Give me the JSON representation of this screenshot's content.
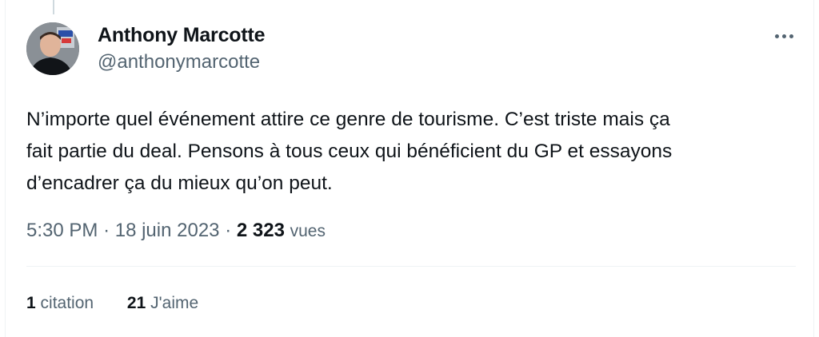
{
  "tweet": {
    "author": {
      "name": "Anthony Marcotte",
      "handle": "@anthonymarcotte",
      "avatar": "avatar-photo"
    },
    "more_icon": "more-horizontal-icon",
    "text_lines": [
      "N’importe quel événement attire ce genre de tourisme. C’est triste mais ça",
      "fait partie du deal. Pensons à tous ceux qui bénéficient du GP et essayons",
      "d’encadrer ça du mieux qu’on peut."
    ],
    "time": "5:30 PM",
    "separator": "·",
    "date": "18 juin 2023",
    "views_count": "2 323",
    "views_label": "vues"
  },
  "stats": {
    "quotes_count": "1",
    "quotes_label": "citation",
    "likes_count": "21",
    "likes_label": "J'aime"
  },
  "colors": {
    "text": "#0f1419",
    "secondary": "#536471",
    "border": "#eff3f4"
  }
}
